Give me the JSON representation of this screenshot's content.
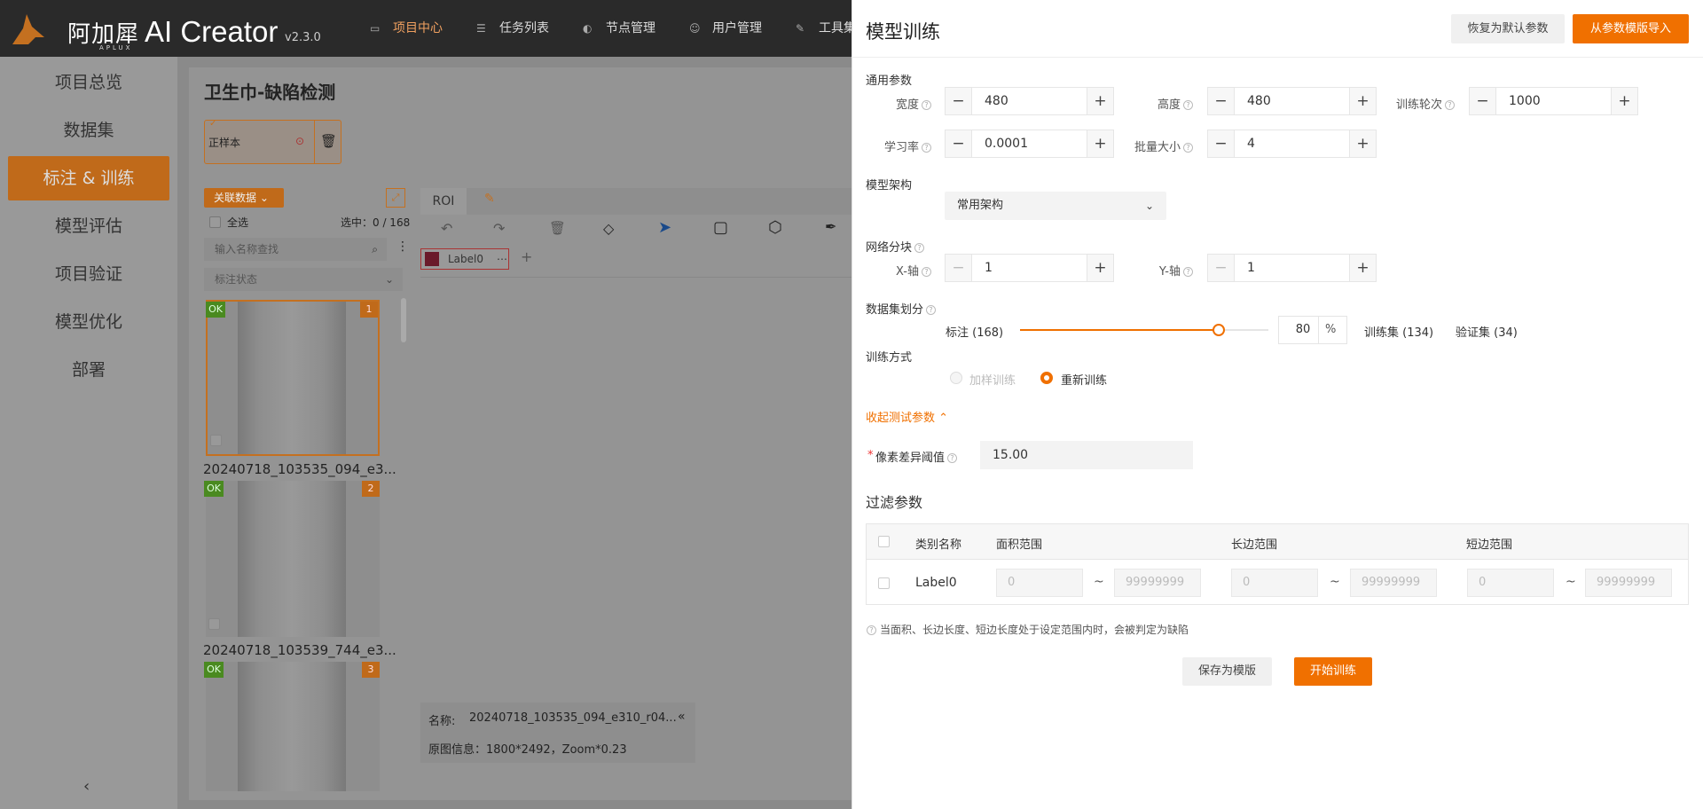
{
  "app": {
    "brand_cn": "阿加犀",
    "brand_sub": "APLUX",
    "brand_name": "AI Creator",
    "version": "v2.3.0"
  },
  "topnav": [
    {
      "label": "项目中心",
      "icon": "folder-icon"
    },
    {
      "label": "任务列表",
      "icon": "list-icon"
    },
    {
      "label": "节点管理",
      "icon": "node-icon"
    },
    {
      "label": "用户管理",
      "icon": "user-icon"
    },
    {
      "label": "工具集",
      "icon": "tool-icon"
    }
  ],
  "sidebar": {
    "items": [
      {
        "label": "项目总览"
      },
      {
        "label": "数据集"
      },
      {
        "label": "标注 & 训练"
      },
      {
        "label": "模型评估"
      },
      {
        "label": "项目验证"
      },
      {
        "label": "模型优化"
      },
      {
        "label": "部署"
      }
    ],
    "active_index": 2,
    "collapse_glyph": "‹"
  },
  "project": {
    "title": "卫生巾-缺陷检测",
    "sample_name": "正样本",
    "assoc_data_label": "关联数据",
    "select_all": "全选",
    "selected_count": "选中：0 / 168",
    "search_placeholder": "输入名称查找",
    "status_placeholder": "标注状态",
    "tool_tab_roi": "ROI",
    "label_chip": "Label0",
    "thumbs": [
      {
        "badge": "OK",
        "index": "1",
        "caption": "20240718_103535_094_e3..."
      },
      {
        "badge": "OK",
        "index": "2",
        "caption": "20240718_103539_744_e3..."
      },
      {
        "badge": "OK",
        "index": "3",
        "caption": ""
      }
    ],
    "info_name_label": "名称:",
    "info_name_value": "20240718_103535_094_e310_r04...",
    "info_meta": "原图信息：1800*2492，Zoom*0.23"
  },
  "panel": {
    "title": "模型训练",
    "reset_label": "恢复为默认参数",
    "import_label": "从参数模版导入",
    "general_section": "通用参数",
    "width_label": "宽度",
    "width_value": "480",
    "height_label": "高度",
    "height_value": "480",
    "epochs_label": "训练轮次",
    "epochs_value": "1000",
    "lr_label": "学习率",
    "lr_value": "0.0001",
    "batch_label": "批量大小",
    "batch_value": "4",
    "arch_section": "模型架构",
    "arch_value": "常用架构",
    "block_section": "网络分块",
    "x_label": "X-轴",
    "x_value": "1",
    "y_label": "Y-轴",
    "y_value": "1",
    "split_section": "数据集划分",
    "split_label": "标注 (168)",
    "split_value": "80",
    "split_fraction": 0.8,
    "pct_symbol": "%",
    "train_set": "训练集 (134)",
    "val_set": "验证集 (34)",
    "method_section": "训练方式",
    "method_options": [
      {
        "label": "加样训练",
        "selected": false,
        "disabled": true
      },
      {
        "label": "重新训练",
        "selected": true,
        "disabled": false
      }
    ],
    "collapse_test_label": "收起测试参数",
    "required_mark": "*",
    "pixel_diff_label": "像素差异阈值",
    "pixel_diff_value": "15.00",
    "filter_section": "过滤参数",
    "table": {
      "headers": [
        "类别名称",
        "面积范围",
        "长边范围",
        "短边范围"
      ],
      "rows": [
        {
          "name": "Label0",
          "area": [
            "0",
            "99999999"
          ],
          "long": [
            "0",
            "99999999"
          ],
          "short": [
            "0",
            "99999999"
          ]
        }
      ]
    },
    "range_sep": "~",
    "note": "当面积、长边长度、短边长度处于设定范围内时，会被判定为缺陷",
    "save_template_label": "保存为模版",
    "start_label": "开始训练",
    "accent": "#f07000"
  }
}
